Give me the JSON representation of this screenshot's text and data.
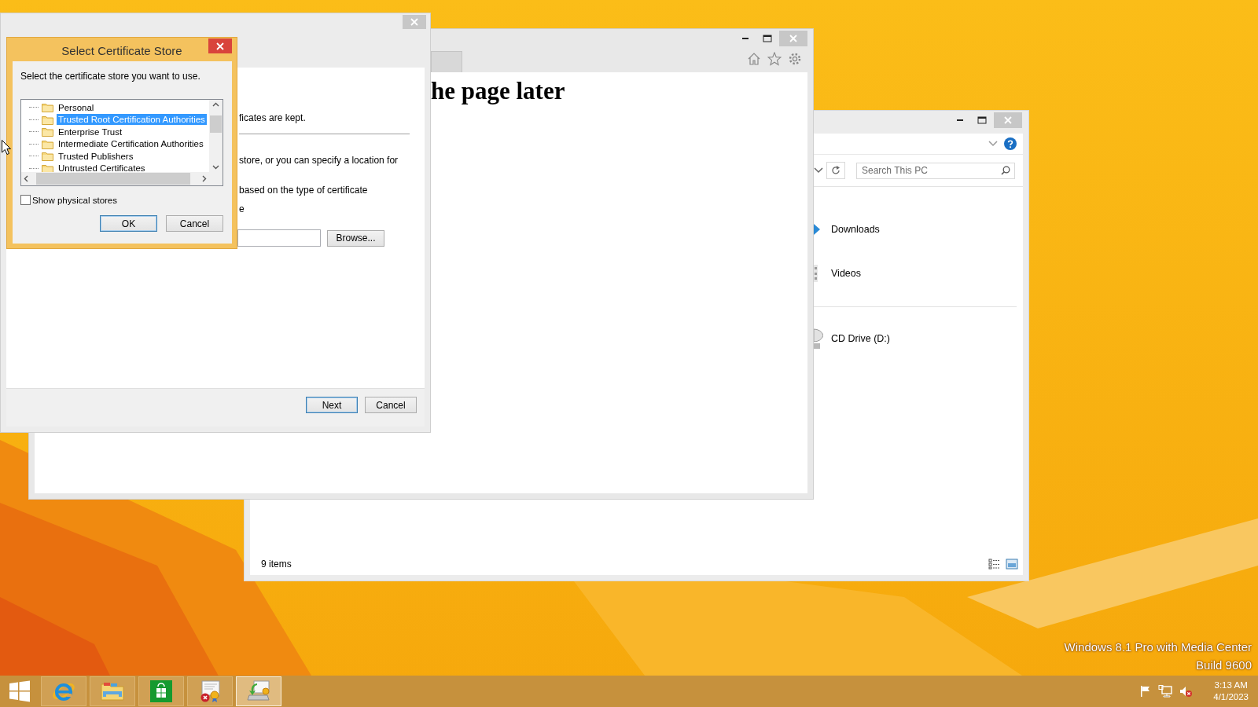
{
  "desktop": {
    "watermark_lines": [
      "Windows 8.1 Pro with Media Center",
      "Build 9600"
    ]
  },
  "explorer_window": {
    "search": {
      "placeholder": "Search This PC"
    },
    "items": [
      {
        "label": "Downloads",
        "kind": "downloads"
      },
      {
        "label": "Videos",
        "kind": "videos"
      },
      {
        "label": "CD Drive (D:)",
        "kind": "cd-drive"
      }
    ],
    "status_bar": {
      "item_count": "9 items"
    }
  },
  "browser_window": {
    "heading": "he page later"
  },
  "wizard_window": {
    "texts": [
      "ficates are kept.",
      "store, or you can specify a location for",
      "based on the type of certificate",
      "e"
    ],
    "browse_button": "Browse...",
    "buttons": [
      {
        "label": "Next",
        "default": true
      },
      {
        "label": "Cancel",
        "default": false
      }
    ]
  },
  "certificate_store_dialog": {
    "title": "Select Certificate Store",
    "instruction": "Select the certificate store you want to use.",
    "stores": [
      {
        "label": "Personal",
        "selected": false
      },
      {
        "label": "Trusted Root Certification Authorities",
        "selected": true
      },
      {
        "label": "Enterprise Trust",
        "selected": false
      },
      {
        "label": "Intermediate Certification Authorities",
        "selected": false
      },
      {
        "label": "Trusted Publishers",
        "selected": false
      },
      {
        "label": "Untrusted Certificates",
        "selected": false
      }
    ],
    "show_physical_stores": {
      "label": "Show physical stores",
      "checked": false
    },
    "buttons": [
      {
        "label": "OK",
        "default": true
      },
      {
        "label": "Cancel",
        "default": false
      }
    ]
  },
  "taskbar": {
    "apps": [
      {
        "kind": "internet-explorer",
        "active": false
      },
      {
        "kind": "file-explorer",
        "active": false
      },
      {
        "kind": "store",
        "active": false
      },
      {
        "kind": "certificate-error",
        "active": false
      },
      {
        "kind": "certificate-install",
        "active": true
      }
    ],
    "tray": [
      {
        "kind": "flag"
      },
      {
        "kind": "network"
      },
      {
        "kind": "volume-muted"
      }
    ],
    "clock": {
      "time": "3:13 AM",
      "date": "4/1/2023"
    }
  }
}
